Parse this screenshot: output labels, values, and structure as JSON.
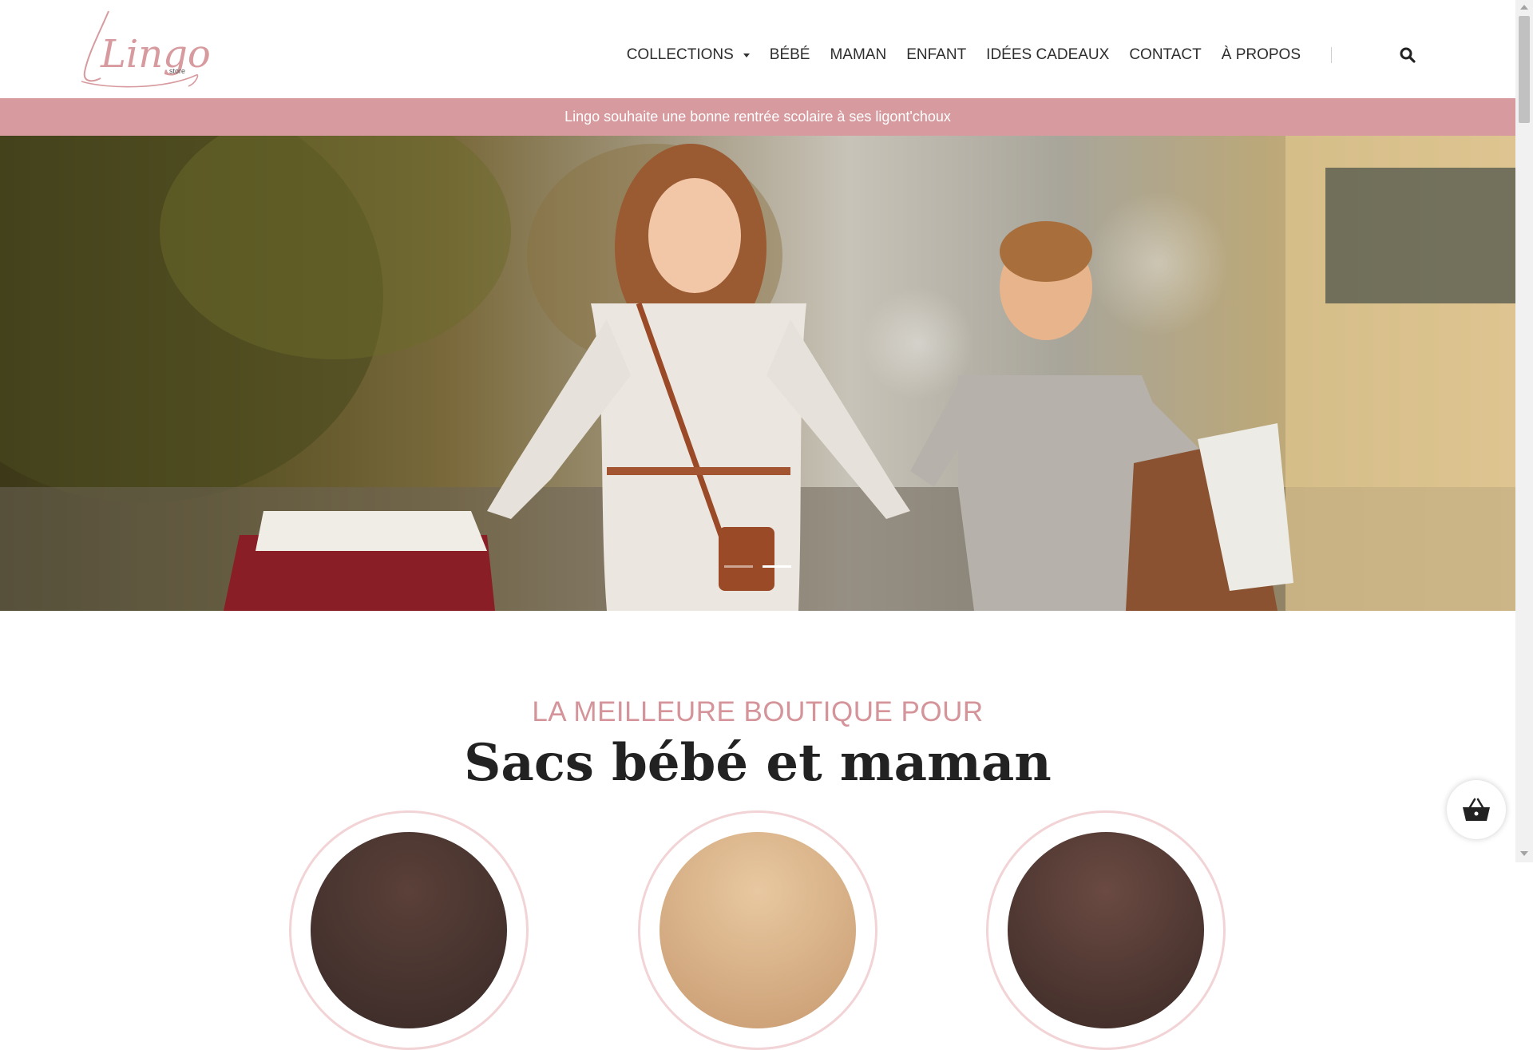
{
  "brand": {
    "name": "Lingo",
    "sub": "store",
    "accent_color": "#d79a9e"
  },
  "nav": {
    "items": [
      {
        "label": "COLLECTIONS",
        "has_dropdown": true
      },
      {
        "label": "BÉBÉ"
      },
      {
        "label": "MAMAN"
      },
      {
        "label": "ENFANT"
      },
      {
        "label": "IDÉES CADEAUX"
      },
      {
        "label": "CONTACT"
      },
      {
        "label": "À PROPOS"
      }
    ],
    "search_icon": "search-icon"
  },
  "announcement": {
    "text": "Lingo souhaite une bonne rentrée scolaire à ses ligont'choux"
  },
  "hero": {
    "slide_count": 2,
    "active_slide": 2
  },
  "section": {
    "kicker": "LA MEILLEURE BOUTIQUE POUR",
    "title": "Sacs bébé et maman"
  },
  "categories": [
    {
      "name": "category-circle-1"
    },
    {
      "name": "category-circle-2"
    },
    {
      "name": "category-circle-3"
    }
  ],
  "cart": {
    "icon": "basket-icon"
  }
}
